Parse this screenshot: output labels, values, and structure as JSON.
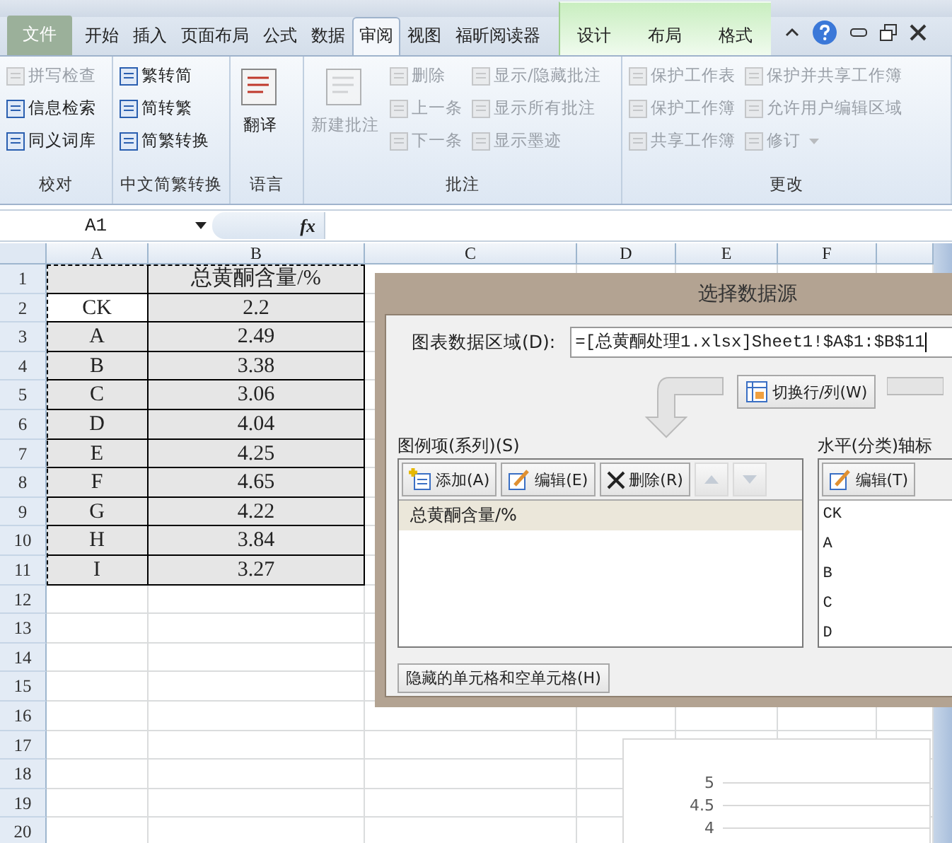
{
  "tabs": [
    {
      "label": "文件",
      "kind": "file",
      "selected": false
    },
    {
      "label": "开始",
      "kind": "main",
      "selected": false
    },
    {
      "label": "插入",
      "kind": "main",
      "selected": false
    },
    {
      "label": "页面布局",
      "kind": "main",
      "selected": false
    },
    {
      "label": "公式",
      "kind": "main",
      "selected": false
    },
    {
      "label": "数据",
      "kind": "main",
      "selected": false
    },
    {
      "label": "审阅",
      "kind": "main",
      "selected": true
    },
    {
      "label": "视图",
      "kind": "main",
      "selected": false
    },
    {
      "label": "福昕阅读器",
      "kind": "main",
      "selected": false
    },
    {
      "label": "设计",
      "kind": "contextual",
      "selected": false
    },
    {
      "label": "布局",
      "kind": "contextual",
      "selected": false
    },
    {
      "label": "格式",
      "kind": "contextual",
      "selected": false
    }
  ],
  "ribbon_groups": [
    {
      "label": "校对",
      "columns": [
        {
          "kind": "list",
          "items": [
            {
              "label": "拼写检查",
              "disabled": true
            },
            {
              "label": "信息检索",
              "disabled": false
            },
            {
              "label": "同义词库",
              "disabled": false
            }
          ]
        }
      ]
    },
    {
      "label": "中文简繁转换",
      "columns": [
        {
          "kind": "list",
          "items": [
            {
              "label": "繁转简",
              "disabled": false
            },
            {
              "label": "简转繁",
              "disabled": false
            },
            {
              "label": "简繁转换",
              "disabled": false
            }
          ]
        }
      ]
    },
    {
      "label": "语言",
      "columns": [
        {
          "kind": "large",
          "items": [
            {
              "label": "翻译",
              "disabled": false
            }
          ]
        }
      ]
    },
    {
      "label": "批注",
      "columns": [
        {
          "kind": "large",
          "items": [
            {
              "label": "新建批注",
              "disabled": true
            }
          ]
        },
        {
          "kind": "list",
          "items": [
            {
              "label": "删除",
              "disabled": true
            },
            {
              "label": "上一条",
              "disabled": true
            },
            {
              "label": "下一条",
              "disabled": true
            }
          ]
        },
        {
          "kind": "list",
          "items": [
            {
              "label": "显示/隐藏批注",
              "disabled": true
            },
            {
              "label": "显示所有批注",
              "disabled": true
            },
            {
              "label": "显示墨迹",
              "disabled": true
            }
          ]
        }
      ]
    },
    {
      "label": "更改",
      "columns": [
        {
          "kind": "list",
          "items": [
            {
              "label": "保护工作表",
              "disabled": true
            },
            {
              "label": "保护工作簿",
              "disabled": true
            },
            {
              "label": "共享工作簿",
              "disabled": true
            }
          ]
        },
        {
          "kind": "list",
          "items": [
            {
              "label": "保护并共享工作簿",
              "disabled": true
            },
            {
              "label": "允许用户编辑区域",
              "disabled": true
            },
            {
              "label": "修订",
              "disabled": true,
              "dropdown": true
            }
          ]
        }
      ]
    }
  ],
  "formula_bar": {
    "name_box": "A1",
    "function_label": "fx"
  },
  "sheet": {
    "columns": [
      "A",
      "B",
      "C",
      "D",
      "E",
      "F"
    ],
    "row_numbers": [
      "1",
      "2",
      "3",
      "4",
      "5",
      "6",
      "7",
      "8",
      "9",
      "10",
      "11",
      "12",
      "13",
      "14",
      "15",
      "16",
      "17",
      "18",
      "19",
      "20"
    ],
    "rows": [
      {
        "cells": [
          {
            "text": "",
            "shaded": true
          },
          {
            "text": "总黄酮含量/%",
            "shaded": true
          }
        ]
      },
      {
        "cells": [
          {
            "text": "CK",
            "shaded": false
          },
          {
            "text": "2.2",
            "shaded": true
          }
        ]
      },
      {
        "cells": [
          {
            "text": "A",
            "shaded": true
          },
          {
            "text": "2.49",
            "shaded": true
          }
        ]
      },
      {
        "cells": [
          {
            "text": "B",
            "shaded": true
          },
          {
            "text": "3.38",
            "shaded": true
          }
        ]
      },
      {
        "cells": [
          {
            "text": "C",
            "shaded": true
          },
          {
            "text": "3.06",
            "shaded": true
          }
        ]
      },
      {
        "cells": [
          {
            "text": "D",
            "shaded": true
          },
          {
            "text": "4.04",
            "shaded": true
          }
        ]
      },
      {
        "cells": [
          {
            "text": "E",
            "shaded": true
          },
          {
            "text": "4.25",
            "shaded": true
          }
        ]
      },
      {
        "cells": [
          {
            "text": "F",
            "shaded": true
          },
          {
            "text": "4.65",
            "shaded": true
          }
        ]
      },
      {
        "cells": [
          {
            "text": "G",
            "shaded": true
          },
          {
            "text": "4.22",
            "shaded": true
          }
        ]
      },
      {
        "cells": [
          {
            "text": "H",
            "shaded": true
          },
          {
            "text": "3.84",
            "shaded": true
          }
        ]
      },
      {
        "cells": [
          {
            "text": "I",
            "shaded": true
          },
          {
            "text": "3.27",
            "shaded": true
          }
        ]
      }
    ]
  },
  "dialog": {
    "title": "选择数据源",
    "range_label": "图表数据区域(D):",
    "range_value": "=[总黄酮处理1.xlsx]Sheet1!$A$1:$B$11",
    "switch_button": "切换行/列(W)",
    "legend_label": "图例项(系列)(S)",
    "legend_buttons": [
      {
        "label": "添加(A)",
        "kind": "add"
      },
      {
        "label": "编辑(E)",
        "kind": "edit"
      },
      {
        "label": "删除(R)",
        "kind": "delete"
      }
    ],
    "series": [
      {
        "label": "总黄酮含量/%",
        "selected": true
      }
    ],
    "axis_label": "水平(分类)轴标",
    "axis_button": "编辑(T)",
    "axis_items": [
      "CK",
      "A",
      "B",
      "C",
      "D"
    ],
    "hidden_cells_button": "隐藏的单元格和空单元格(H)"
  },
  "chart": {
    "tick_labels": [
      "5",
      "4.5",
      "4"
    ]
  }
}
